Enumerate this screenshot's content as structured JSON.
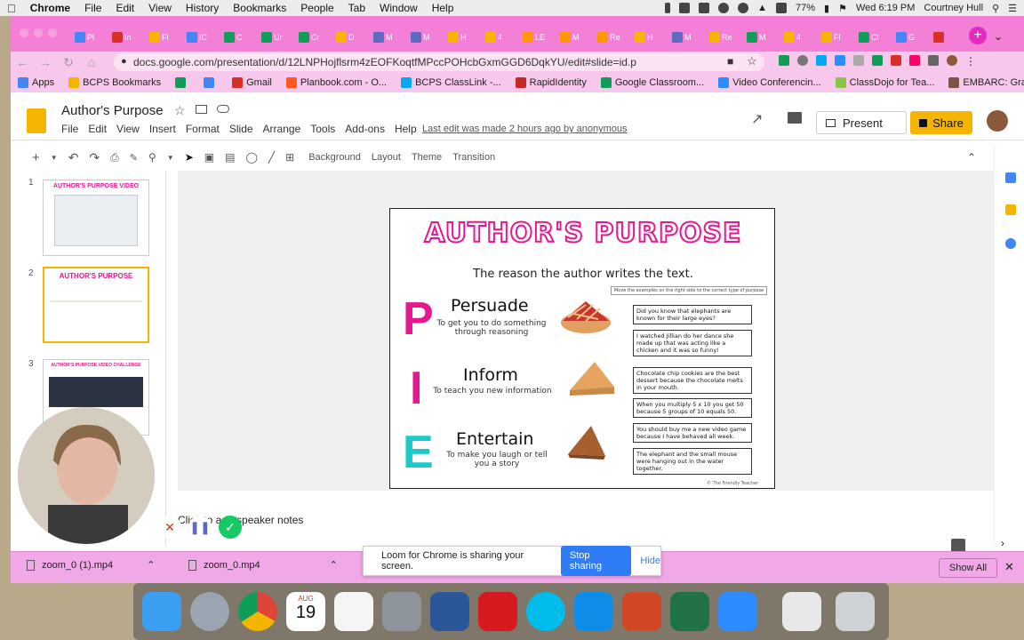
{
  "menubar": {
    "app": "Chrome",
    "items": [
      "File",
      "Edit",
      "View",
      "History",
      "Bookmarks",
      "People",
      "Tab",
      "Window",
      "Help"
    ],
    "battery": "77%",
    "datetime": "Wed 6:19 PM",
    "user": "Courtney Hull"
  },
  "browser": {
    "tabs": [
      {
        "label": "Pl",
        "color": "#4285f4"
      },
      {
        "label": "In",
        "color": "#d93025"
      },
      {
        "label": "Fl",
        "color": "#f4b400"
      },
      {
        "label": "IC",
        "color": "#4285f4"
      },
      {
        "label": "C",
        "color": "#0f9d58"
      },
      {
        "label": "Ur",
        "color": "#0f9d58"
      },
      {
        "label": "Cr",
        "color": "#0f9d58"
      },
      {
        "label": "D",
        "color": "#f4b400"
      },
      {
        "label": "M",
        "color": "#5c6bc0"
      },
      {
        "label": "M",
        "color": "#5c6bc0"
      },
      {
        "label": "H",
        "color": "#f4b400"
      },
      {
        "label": "4",
        "color": "#f4b400"
      },
      {
        "label": "LE",
        "color": "#ff9800"
      },
      {
        "label": "M",
        "color": "#ff9800"
      },
      {
        "label": "Re",
        "color": "#ff9800"
      },
      {
        "label": "H",
        "color": "#f4b400"
      },
      {
        "label": "M",
        "color": "#5c6bc0"
      },
      {
        "label": "Re",
        "color": "#f4b400"
      },
      {
        "label": "M",
        "color": "#0f9d58"
      },
      {
        "label": "4",
        "color": "#f4b400"
      },
      {
        "label": "Fl",
        "color": "#f4b400"
      },
      {
        "label": "Cl",
        "color": "#0f9d58"
      },
      {
        "label": "G",
        "color": "#4285f4"
      },
      {
        "label": "",
        "color": "#d93025"
      }
    ],
    "url": "docs.google.com/presentation/d/12LNPHojflsrm4zEOFKoqtfMPccPOHcbGxmGGD6DqkYU/edit#slide=id.p",
    "bookmarks": [
      {
        "label": "Apps",
        "color": "#4285f4"
      },
      {
        "label": "BCPS Bookmarks",
        "color": "#f4b400"
      },
      {
        "label": "",
        "color": "#0f9d58"
      },
      {
        "label": "",
        "color": "#4285f4"
      },
      {
        "label": "Gmail",
        "color": "#d93025"
      },
      {
        "label": "Planbook.com - O...",
        "color": "#ff5722"
      },
      {
        "label": "BCPS ClassLink -...",
        "color": "#03a9f4"
      },
      {
        "label": "RapidIdentity",
        "color": "#c62828"
      },
      {
        "label": "Google Classroom...",
        "color": "#0f9d58"
      },
      {
        "label": "Video Conferencin...",
        "color": "#2d8cff"
      },
      {
        "label": "ClassDojo for Tea...",
        "color": "#8bc34a"
      },
      {
        "label": "EMBARC: Grade 4",
        "color": "#795548"
      }
    ]
  },
  "app": {
    "title": "Author's Purpose",
    "menus": [
      "File",
      "Edit",
      "View",
      "Insert",
      "Format",
      "Slide",
      "Arrange",
      "Tools",
      "Add-ons",
      "Help"
    ],
    "last_edit": "Last edit was made 2 hours ago by anonymous",
    "present": "Present",
    "share": "Share",
    "toolbar": {
      "background": "Background",
      "layout": "Layout",
      "theme": "Theme",
      "transition": "Transition"
    },
    "speaker_notes": "Click to add speaker notes",
    "thumbs": [
      {
        "num": "1",
        "title": "AUTHOR'S PURPOSE VIDEO"
      },
      {
        "num": "2",
        "title": "AUTHOR'S PURPOSE"
      },
      {
        "num": "3",
        "title": "AUTHOR'S PURPOSE VIDEO CHALLENGE"
      }
    ]
  },
  "slide": {
    "title": "AUTHOR'S PURPOSE",
    "subtitle": "The reason the author writes the text.",
    "instruction": "Move the examples on the right side to the correct type of purpose",
    "purposes": [
      {
        "letter": "P",
        "name": "Persuade",
        "desc": "To get you to do something through reasoning",
        "color": "#e6178f"
      },
      {
        "letter": "I",
        "name": "Inform",
        "desc": "To teach you new information",
        "color": "#e6178f"
      },
      {
        "letter": "E",
        "name": "Entertain",
        "desc": "To make you laugh or tell you a story",
        "color": "#1ccac9"
      }
    ],
    "cards": [
      "Did you know that elephants are known for their large eyes?",
      "I watched Jillian do her dance she made up that was acting like a chicken and it was so funny!",
      "Chocolate chip cookies are the best dessert because the chocolate melts in your mouth.",
      "When you multiply 5 x 10 you get 50 because 5 groups of 10 equals 50.",
      "You should buy me a new video game because I have behaved all week.",
      "The elephant and the small mouse were hanging out in the water together."
    ],
    "credit": "© The Friendly Teacher"
  },
  "downloads": {
    "items": [
      "zoom_0 (1).mp4",
      "zoom_0.mp4"
    ],
    "show_all": "Show All"
  },
  "loom": {
    "message": "Loom for Chrome is sharing your screen.",
    "stop": "Stop sharing",
    "hide": "Hide"
  },
  "dock": {
    "calendar_month": "AUG",
    "calendar_day": "19"
  }
}
